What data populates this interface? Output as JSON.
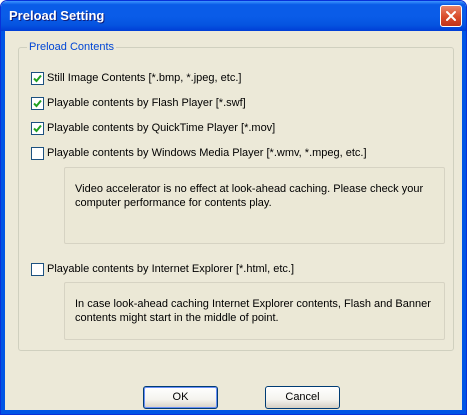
{
  "window": {
    "title": "Preload Setting"
  },
  "group": {
    "legend": "Preload Contents",
    "options": [
      {
        "label": "Still Image Contents [*.bmp, *.jpeg, etc.]",
        "checked": true
      },
      {
        "label": "Playable contents by Flash Player [*.swf]",
        "checked": true
      },
      {
        "label": "Playable contents by QuickTime Player [*.mov]",
        "checked": true
      },
      {
        "label": "Playable contents by Windows Media Player [*.wmv, *.mpeg, etc.]",
        "checked": false
      },
      {
        "label": "Playable contents by Internet Explorer [*.html, etc.]",
        "checked": false
      }
    ],
    "notes": {
      "media_player": "Video accelerator is no effect at look-ahead caching. Please check your computer performance for contents play.",
      "internet_explorer": "In case look-ahead caching Internet Explorer contents, Flash and Banner contents might start in the middle of point."
    }
  },
  "buttons": {
    "ok": "OK",
    "cancel": "Cancel"
  },
  "colors": {
    "titlebar": "#0a5ce8",
    "dialog_bg": "#ece9d8",
    "legend_text": "#0046d5",
    "check_mark": "#21a121"
  }
}
